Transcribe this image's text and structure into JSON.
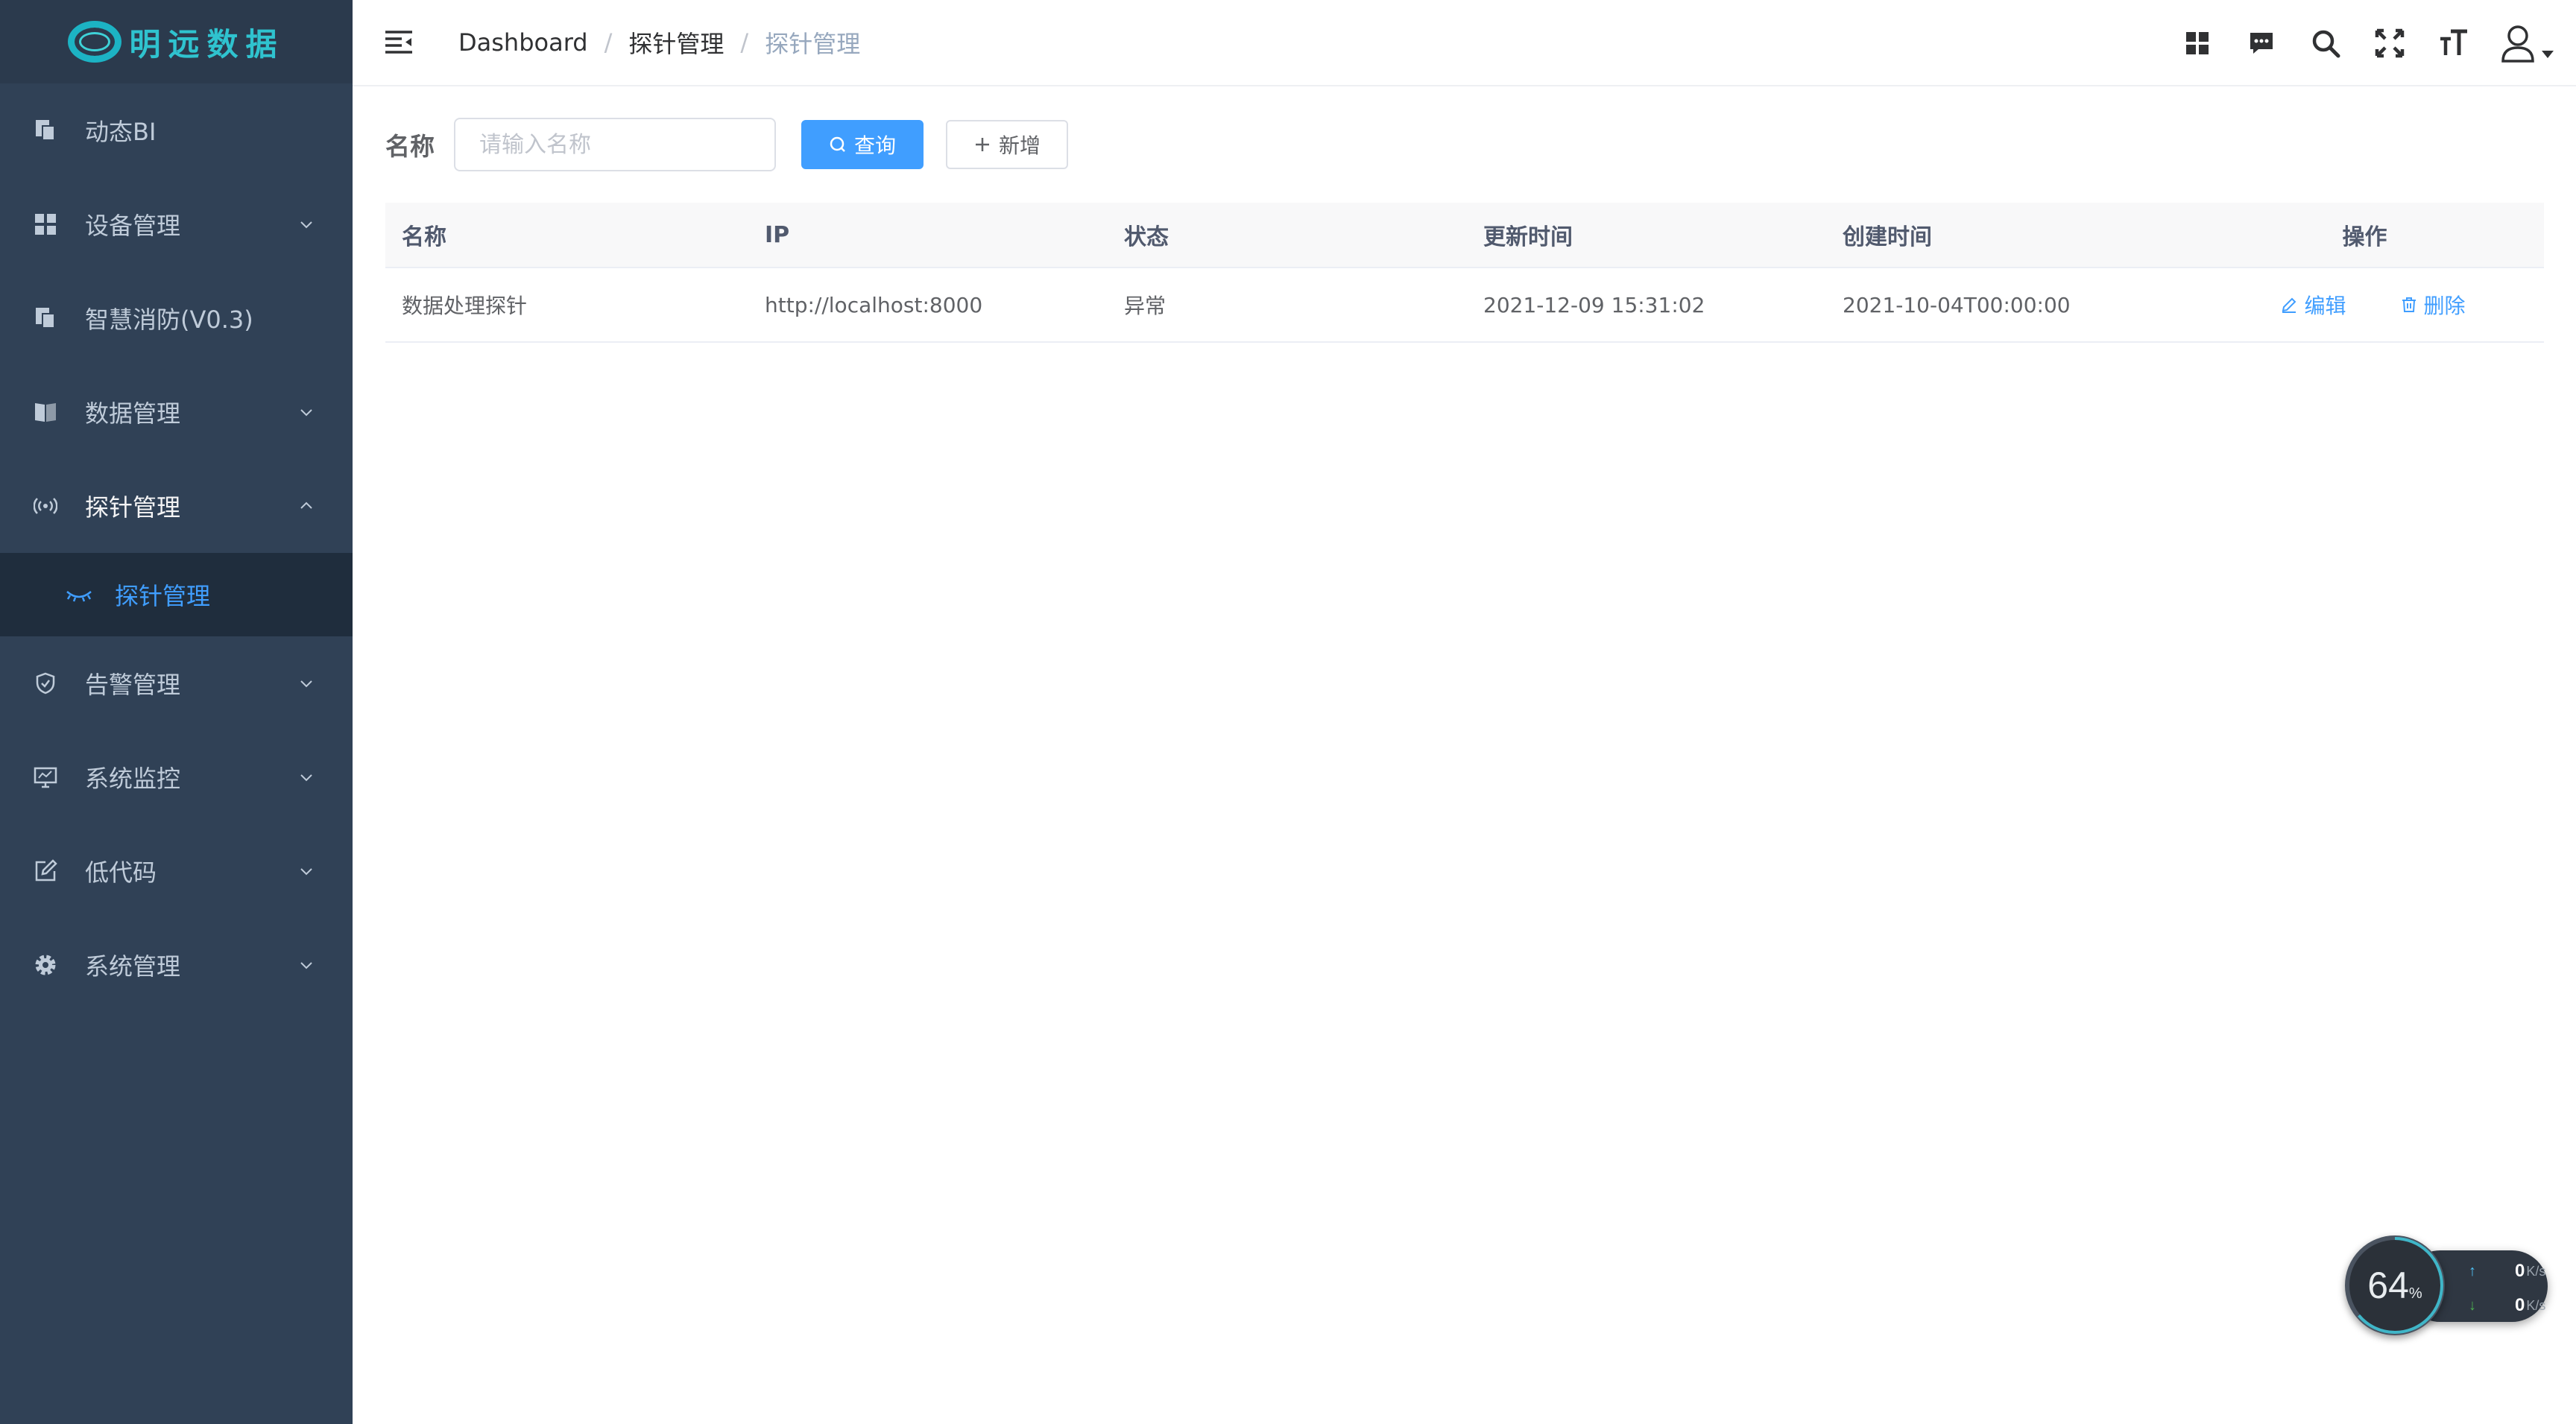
{
  "app": {
    "logo_text": "明远数据"
  },
  "sidebar": {
    "items": [
      {
        "label": "动态BI",
        "icon": "document-copy-icon",
        "has_arrow": false
      },
      {
        "label": "设备管理",
        "icon": "grid-icon",
        "has_arrow": true
      },
      {
        "label": "智慧消防(V0.3)",
        "icon": "document-copy-icon",
        "has_arrow": false
      },
      {
        "label": "数据管理",
        "icon": "book-icon",
        "has_arrow": true
      },
      {
        "label": "探针管理",
        "icon": "signal-icon",
        "has_arrow": true,
        "open": true
      },
      {
        "label": "告警管理",
        "icon": "shield-icon",
        "has_arrow": true
      },
      {
        "label": "系统监控",
        "icon": "monitor-icon",
        "has_arrow": true
      },
      {
        "label": "低代码",
        "icon": "edit-icon",
        "has_arrow": true
      },
      {
        "label": "系统管理",
        "icon": "gear-icon",
        "has_arrow": true
      }
    ],
    "sub_item": {
      "label": "探针管理",
      "icon": "eye-closed-icon",
      "active": true
    }
  },
  "header": {
    "breadcrumb": [
      "Dashboard",
      "探针管理",
      "探针管理"
    ],
    "separator": "/",
    "tools": [
      "apps-grid-icon",
      "message-icon",
      "search-icon",
      "fullscreen-icon",
      "font-size-icon",
      "user-icon"
    ]
  },
  "search": {
    "label": "名称",
    "placeholder": "请输入名称",
    "value": "",
    "query_button": "查询",
    "add_button": "新增"
  },
  "table": {
    "columns": [
      "名称",
      "IP",
      "状态",
      "更新时间",
      "创建时间",
      "操作"
    ],
    "rows": [
      {
        "name": "数据处理探针",
        "ip": "http://localhost:8000",
        "status": "异常",
        "updated": "2021-12-09 15:31:02",
        "created": "2021-10-04T00:00:00",
        "actions": [
          "编辑",
          "删除"
        ]
      }
    ]
  },
  "net_widget": {
    "percent": "64",
    "percent_unit": "%",
    "upload": "0",
    "download": "0",
    "unit": "K/s"
  },
  "colors": {
    "sidebar_bg": "#304156",
    "sidebar_sub_bg": "#1f2d3d",
    "accent": "#409eff",
    "logo": "#2fc3cf"
  }
}
